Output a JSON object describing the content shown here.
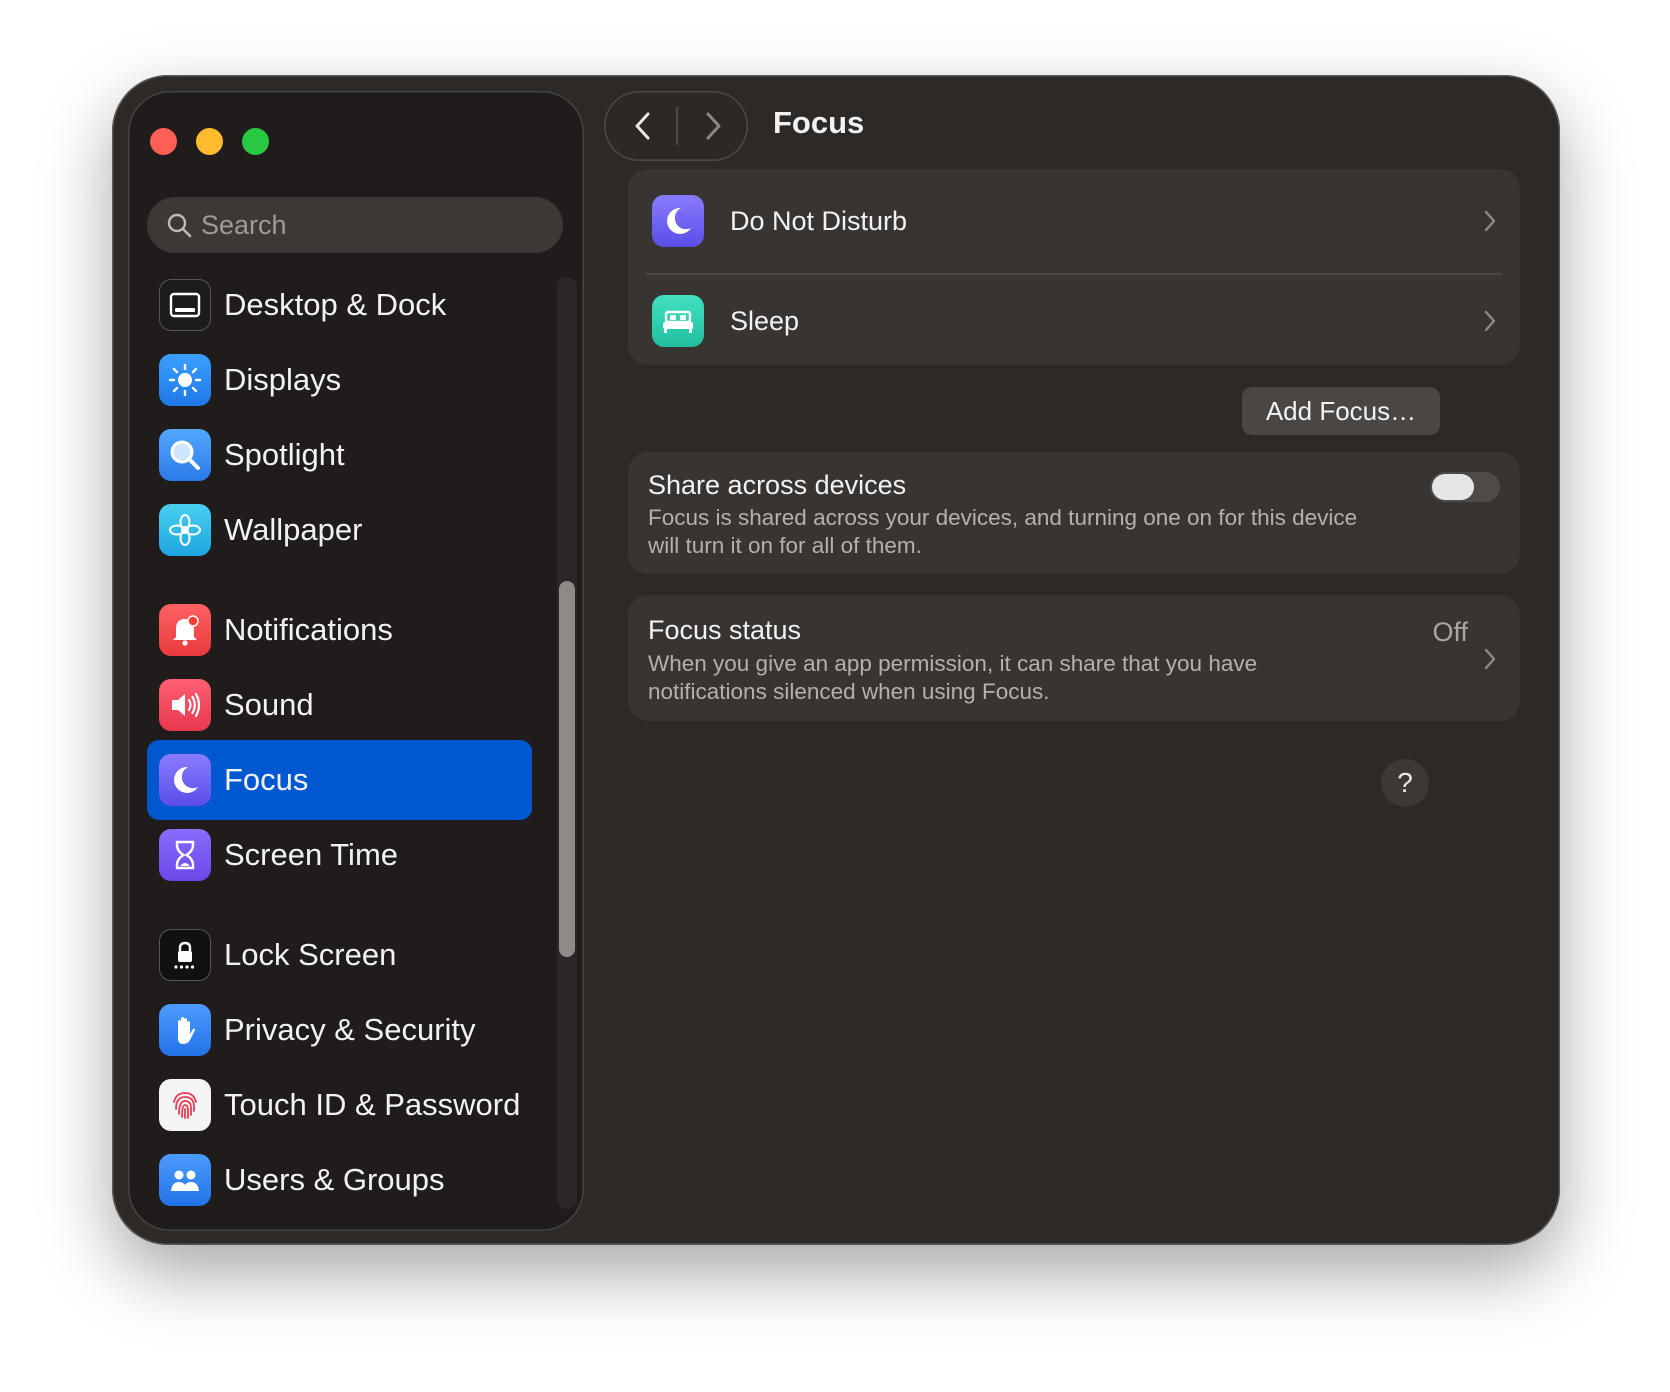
{
  "window": {
    "traffic_lights": [
      "close",
      "minimize",
      "zoom"
    ]
  },
  "sidebar": {
    "search_placeholder": "Search",
    "items": [
      {
        "label": "Desktop & Dock",
        "icon": "desktop-dock-icon",
        "color": "#1c1c1e"
      },
      {
        "label": "Displays",
        "icon": "sun-icon",
        "color": "#2d8cf0"
      },
      {
        "label": "Spotlight",
        "icon": "magnifier-icon",
        "color": "#3a8ef0"
      },
      {
        "label": "Wallpaper",
        "icon": "flower-icon",
        "color": "#2eb8e6"
      },
      {
        "label": "Notifications",
        "icon": "bell-icon",
        "color": "#f0474a"
      },
      {
        "label": "Sound",
        "icon": "speaker-icon",
        "color": "#f0465a"
      },
      {
        "label": "Focus",
        "icon": "moon-icon",
        "color": "#6a5cf0",
        "active": true
      },
      {
        "label": "Screen Time",
        "icon": "hourglass-icon",
        "color": "#7a5cf0"
      },
      {
        "label": "Lock Screen",
        "icon": "lock-icon",
        "color": "#111111"
      },
      {
        "label": "Privacy & Security",
        "icon": "hand-icon",
        "color": "#2d7ff0"
      },
      {
        "label": "Touch ID & Password",
        "icon": "fingerprint-icon",
        "color": "#f5f5f5"
      },
      {
        "label": "Users & Groups",
        "icon": "users-icon",
        "color": "#2d7ff0"
      }
    ]
  },
  "header": {
    "title": "Focus"
  },
  "focus_modes": [
    {
      "label": "Do Not Disturb",
      "icon": "moon-icon",
      "color": "#6a5cf0"
    },
    {
      "label": "Sleep",
      "icon": "bed-icon",
      "color": "#2fd2b4"
    }
  ],
  "add_focus_label": "Add Focus…",
  "share": {
    "title": "Share across devices",
    "description": "Focus is shared across your devices, and turning one on for this device will turn it on for all of them.",
    "enabled": false
  },
  "status": {
    "title": "Focus status",
    "value": "Off",
    "description": "When you give an app permission, it can share that you have notifications silenced when using Focus."
  },
  "help_label": "?"
}
